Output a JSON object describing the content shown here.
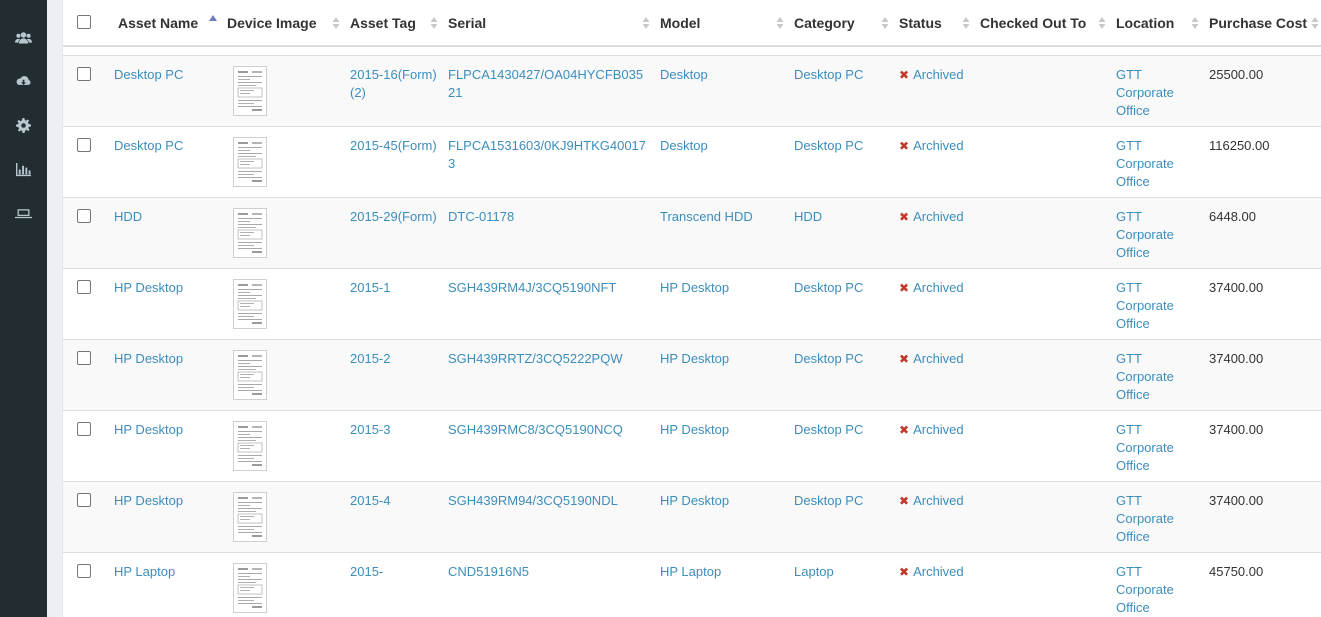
{
  "sidebar": {
    "icons": [
      "users-icon",
      "cloud-download-icon",
      "gear-icon",
      "bar-chart-icon",
      "laptop-icon"
    ]
  },
  "table": {
    "columns": {
      "asset_name": "Asset Name",
      "device_image": "Device Image",
      "asset_tag": "Asset Tag",
      "serial": "Serial",
      "model": "Model",
      "category": "Category",
      "status": "Status",
      "checked_out_to": "Checked Out To",
      "location": "Location",
      "purchase_cost": "Purchase Cost"
    },
    "status_icon_color": "#c0392b",
    "link_color": "#3c8dbc",
    "rows": [
      {
        "name": "Desktop PC",
        "tag": "2015-16(Form)(2)",
        "serial": "FLPCA1430427/OA04HYCFB03521",
        "model": "Desktop",
        "category": "Desktop PC",
        "status": "Archived",
        "checked_out_to": "",
        "location": "GTT Corporate Office",
        "cost": "25500.00"
      },
      {
        "name": "Desktop PC",
        "tag": "2015-45(Form)",
        "serial": "FLPCA1531603/0KJ9HTKG400173",
        "model": "Desktop",
        "category": "Desktop PC",
        "status": "Archived",
        "checked_out_to": "",
        "location": "GTT Corporate Office",
        "cost": "116250.00"
      },
      {
        "name": "HDD",
        "tag": "2015-29(Form)",
        "serial": "DTC-01178",
        "model": "Transcend HDD",
        "category": "HDD",
        "status": "Archived",
        "checked_out_to": "",
        "location": "GTT Corporate Office",
        "cost": "6448.00"
      },
      {
        "name": "HP Desktop",
        "tag": "2015-1",
        "serial": "SGH439RM4J/3CQ5190NFT",
        "model": "HP Desktop",
        "category": "Desktop PC",
        "status": "Archived",
        "checked_out_to": "",
        "location": "GTT Corporate Office",
        "cost": "37400.00"
      },
      {
        "name": "HP Desktop",
        "tag": "2015-2",
        "serial": "SGH439RRTZ/3CQ5222PQW",
        "model": "HP Desktop",
        "category": "Desktop PC",
        "status": "Archived",
        "checked_out_to": "",
        "location": "GTT Corporate Office",
        "cost": "37400.00"
      },
      {
        "name": "HP Desktop",
        "tag": "2015-3",
        "serial": "SGH439RMC8/3CQ5190NCQ",
        "model": "HP Desktop",
        "category": "Desktop PC",
        "status": "Archived",
        "checked_out_to": "",
        "location": "GTT Corporate Office",
        "cost": "37400.00"
      },
      {
        "name": "HP Desktop",
        "tag": "2015-4",
        "serial": "SGH439RM94/3CQ5190NDL",
        "model": "HP Desktop",
        "category": "Desktop PC",
        "status": "Archived",
        "checked_out_to": "",
        "location": "GTT Corporate Office",
        "cost": "37400.00"
      },
      {
        "name": "HP Laptop",
        "tag": "2015-",
        "serial": "CND51916N5",
        "model": "HP Laptop",
        "category": "Laptop",
        "status": "Archived",
        "checked_out_to": "",
        "location": "GTT Corporate Office",
        "cost": "45750.00"
      }
    ]
  }
}
